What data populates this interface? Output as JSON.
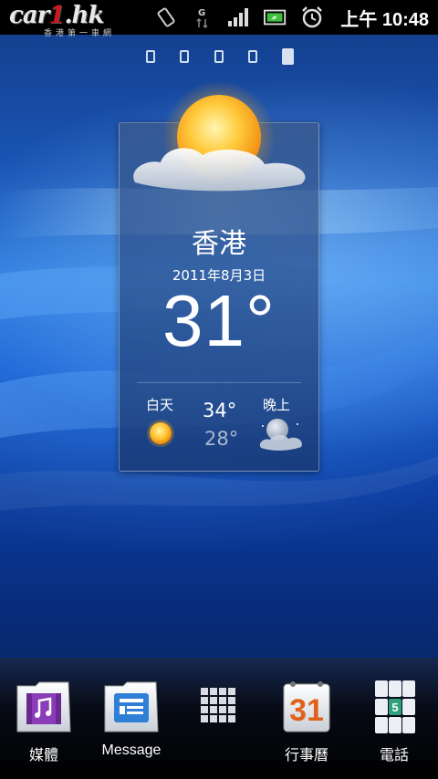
{
  "status_bar": {
    "logo_text_main": "car",
    "logo_text_num": "1",
    "logo_text_tail": ".hk",
    "logo_tagline": "香港第一車網",
    "icons": [
      "usb-icon",
      "notification-icon",
      "screen-rotate-icon",
      "data-g-icon",
      "signal-icon",
      "battery-icon",
      "alarm-icon"
    ],
    "time": "上午 10:48"
  },
  "home": {
    "page_count": 5,
    "active_page": 5
  },
  "weather": {
    "city": "香港",
    "date": "2011年8月3日",
    "current_temp": "31°",
    "day_label": "白天",
    "night_label": "晚上",
    "high": "34°",
    "low": "28°"
  },
  "dock": {
    "items": [
      {
        "label": "媒體",
        "icon": "media-icon"
      },
      {
        "label": "Message",
        "icon": "message-icon"
      },
      {
        "label": "",
        "icon": "app-drawer-icon"
      },
      {
        "label": "行事曆",
        "icon": "calendar-icon",
        "icon_text": "31"
      },
      {
        "label": "電話",
        "icon": "phone-dialer-icon",
        "icon_text": "5"
      }
    ]
  },
  "colors": {
    "status_bar_bg": "#000000",
    "wallpaper_accent": "#2f7fe0",
    "logo_red": "#d01616",
    "calendar_orange": "#e0621a",
    "dialer_green": "#2fa07a"
  }
}
